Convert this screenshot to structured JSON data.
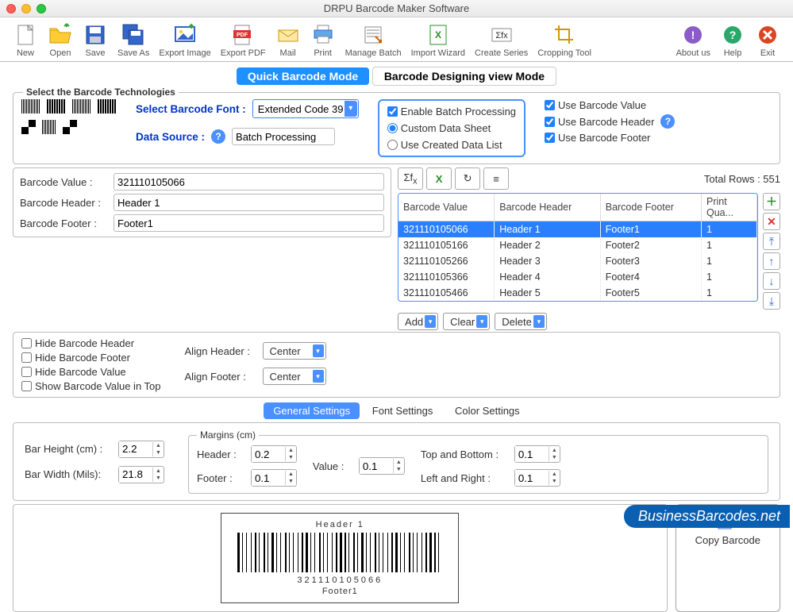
{
  "window": {
    "title": "DRPU Barcode Maker Software"
  },
  "toolbar": {
    "new": "New",
    "open": "Open",
    "save": "Save",
    "saveas": "Save As",
    "exportimg": "Export Image",
    "exportpdf": "Export PDF",
    "mail": "Mail",
    "print": "Print",
    "batch": "Manage Batch",
    "wizard": "Import Wizard",
    "series": "Create Series",
    "crop": "Cropping Tool",
    "about": "About us",
    "help": "Help",
    "exit": "Exit"
  },
  "modes": {
    "quick": "Quick Barcode Mode",
    "design": "Barcode Designing view Mode"
  },
  "tech": {
    "legend": "Select the Barcode Technologies",
    "font_label": "Select Barcode Font :",
    "font_value": "Extended Code 39",
    "source_label": "Data Source :",
    "source_value": "Batch Processing"
  },
  "batch": {
    "enable": "Enable Batch Processing",
    "custom": "Custom Data Sheet",
    "created": "Use Created Data List",
    "use_value": "Use Barcode Value",
    "use_header": "Use Barcode Header",
    "use_footer": "Use Barcode Footer"
  },
  "values": {
    "bv_label": "Barcode Value :",
    "bv": "321110105066",
    "bh_label": "Barcode Header :",
    "bh": "Header 1",
    "bf_label": "Barcode Footer :",
    "bf": "Footer1"
  },
  "total_rows_label": "Total Rows : ",
  "total_rows": "551",
  "table": {
    "cols": [
      "Barcode Value",
      "Barcode Header",
      "Barcode Footer",
      "Print Qua..."
    ],
    "rows": [
      {
        "v": "321110105066",
        "h": "Header 1",
        "f": "Footer1",
        "q": "1"
      },
      {
        "v": "321110105166",
        "h": "Header 2",
        "f": "Footer2",
        "q": "1"
      },
      {
        "v": "321110105266",
        "h": "Header 3",
        "f": "Footer3",
        "q": "1"
      },
      {
        "v": "321110105366",
        "h": "Header 4",
        "f": "Footer4",
        "q": "1"
      },
      {
        "v": "321110105466",
        "h": "Header 5",
        "f": "Footer5",
        "q": "1"
      }
    ],
    "add": "Add",
    "clear": "Clear",
    "delete": "Delete"
  },
  "opts": {
    "hide_header": "Hide Barcode Header",
    "hide_footer": "Hide Barcode Footer",
    "hide_value": "Hide Barcode Value",
    "show_top": "Show Barcode Value in Top",
    "align_header_label": "Align Header :",
    "align_header": "Center",
    "align_footer_label": "Align Footer :",
    "align_footer": "Center"
  },
  "settings_tabs": {
    "general": "General Settings",
    "font": "Font Settings",
    "color": "Color Settings"
  },
  "dims": {
    "bar_height_label": "Bar Height (cm) :",
    "bar_height": "2.2",
    "bar_width_label": "Bar Width (Mils):",
    "bar_width": "21.8"
  },
  "margins": {
    "legend": "Margins (cm)",
    "header_label": "Header :",
    "header": "0.2",
    "footer_label": "Footer :",
    "footer": "0.1",
    "value_label": "Value :",
    "value": "0.1",
    "tb_label": "Top and Bottom :",
    "tb": "0.1",
    "lr_label": "Left and Right :",
    "lr": "0.1"
  },
  "preview": {
    "header": "Header 1",
    "value": "321110105066",
    "footer": "Footer1",
    "copy": "Copy Barcode"
  },
  "brand": "BusinessBarcodes",
  "brand_ext": ".net"
}
